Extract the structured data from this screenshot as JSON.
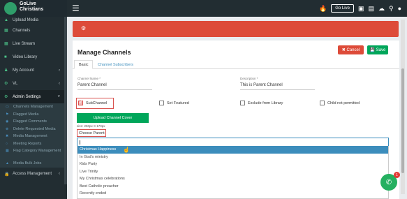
{
  "brand": {
    "name_line1": "GoLive",
    "name_line2": "Christians",
    "accent": "#dd4b39",
    "green": "#00a65a"
  },
  "topbar": {
    "golive_button": "Go Live",
    "icons": [
      "fire-icon",
      "message-icon",
      "briefcase-icon",
      "cloud-upload-icon",
      "search-icon",
      "user-icon"
    ]
  },
  "sidebar": {
    "items": [
      {
        "label": "Upload Media",
        "icon": "upload-icon"
      },
      {
        "label": "Channels",
        "icon": "channels-icon"
      },
      {
        "label": "Live Stream",
        "icon": "live-icon"
      },
      {
        "label": "Video Library",
        "icon": "video-icon"
      },
      {
        "label": "My Account",
        "icon": "user-icon"
      },
      {
        "label": "VL",
        "icon": "vl-icon"
      },
      {
        "label": "Admin Settings",
        "icon": "settings-icon"
      }
    ],
    "admin_sub": [
      {
        "label": "Channels Management"
      },
      {
        "label": "Flagged Media"
      },
      {
        "label": "Flagged Comments"
      },
      {
        "label": "Delete Requested Media"
      },
      {
        "label": "Media Management"
      },
      {
        "label": "Meeting Reports"
      },
      {
        "label": "Flag Category Management"
      },
      {
        "label": "Media Bulk Jobs"
      }
    ],
    "last": {
      "label": "Access Management"
    }
  },
  "panel": {
    "title": "Manage Channels",
    "cancel_label": "Cancel",
    "save_label": "Save",
    "tabs": [
      "Basic",
      "Channel Subscribers"
    ],
    "channel_name_label": "Channel Name *",
    "channel_name_value": "Parent Channel",
    "description_label": "Description *",
    "description_value": "This is Parent Channel",
    "checkboxes": {
      "subchannel": "SubChannel",
      "featured": "Set Featured",
      "exclude": "Exclude from Library",
      "child": "Child not permitted"
    },
    "upload_cover_label": "Upload Channel Cover",
    "size_note": "size: 250px X 170px",
    "choose_parent_label": "Choose Parent",
    "options": [
      "Christmas Happiness",
      "In God's ministry",
      "Kids Party",
      "Live Trinity",
      "My Christmas celebrations",
      "Best Catholic preacher",
      "Recently ended"
    ]
  },
  "chat": {
    "badge": "1"
  }
}
